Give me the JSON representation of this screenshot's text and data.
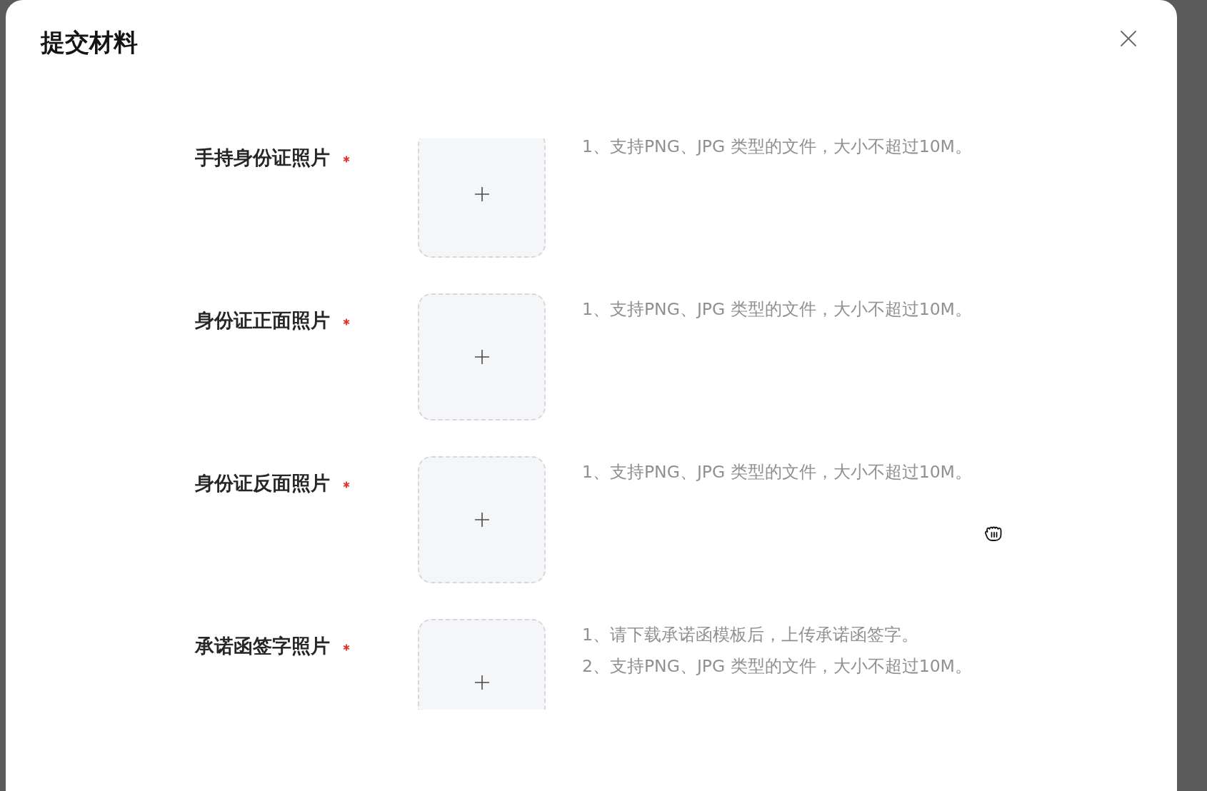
{
  "dialog": {
    "title": "提交材料"
  },
  "fields": [
    {
      "label": "手持身份证照片",
      "required": true,
      "hints": [
        "1、支持PNG、JPG 类型的文件，大小不超过10M。"
      ]
    },
    {
      "label": "身份证正面照片",
      "required": true,
      "hints": [
        "1、支持PNG、JPG 类型的文件，大小不超过10M。"
      ]
    },
    {
      "label": "身份证反面照片",
      "required": true,
      "hints": [
        "1、支持PNG、JPG 类型的文件，大小不超过10M。"
      ]
    },
    {
      "label": "承诺函签字照片",
      "required": true,
      "hints": [
        "1、请下载承诺函模板后，上传承诺函签字。",
        "2、支持PNG、JPG 类型的文件，大小不超过10M。"
      ]
    }
  ]
}
